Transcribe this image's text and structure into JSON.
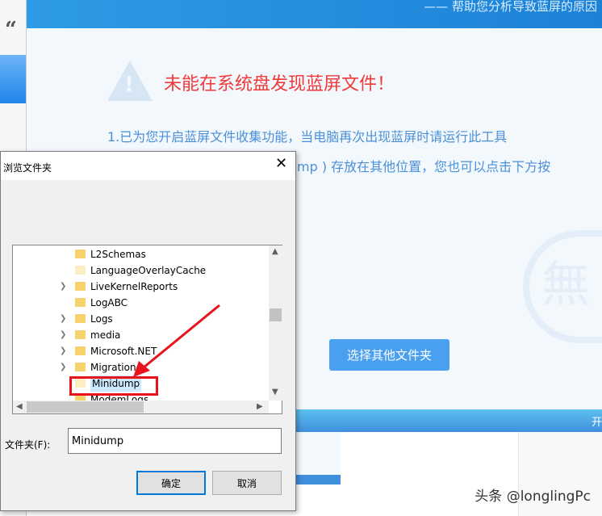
{
  "app": {
    "subtitle": "—— 帮助您分析导致蓝屏的原因",
    "error_title": "未能在系统盘发现蓝屏文件！",
    "line1": "1.已为您开启蓝屏文件收集功能，当电脑再次出现蓝屏时请运行此工具",
    "line2": "mp ) 存放在其他位置，您也可以点击下方按",
    "select_button": "选择其他文件夹",
    "bottom_bar_text": "开",
    "quote_glyph": "“",
    "logo_glyph": "無"
  },
  "dialog": {
    "title": "浏览文件夹",
    "close_icon": "close-icon",
    "tree_items": [
      {
        "name": "L2Schemas",
        "expandable": false,
        "light": false
      },
      {
        "name": "LanguageOverlayCache",
        "expandable": false,
        "light": true
      },
      {
        "name": "LiveKernelReports",
        "expandable": true,
        "light": false
      },
      {
        "name": "LogABC",
        "expandable": false,
        "light": false
      },
      {
        "name": "Logs",
        "expandable": true,
        "light": false
      },
      {
        "name": "media",
        "expandable": true,
        "light": false
      },
      {
        "name": "Microsoft.NET",
        "expandable": true,
        "light": false
      },
      {
        "name": "Migration",
        "expandable": true,
        "light": false
      },
      {
        "name": "Minidump",
        "expandable": false,
        "light": true,
        "selected": true
      },
      {
        "name": "ModemLogs",
        "expandable": false,
        "light": false
      }
    ],
    "folder_label": "文件夹(F):",
    "folder_value": "Minidump",
    "ok": "确定",
    "cancel": "取消"
  },
  "watermark": "头条 @longlingPc",
  "colors": {
    "header": "#1c82d8",
    "error": "#f03a3a",
    "text_blue": "#4a90d9",
    "button": "#4aa0f0",
    "highlight_box": "#e8141b"
  }
}
